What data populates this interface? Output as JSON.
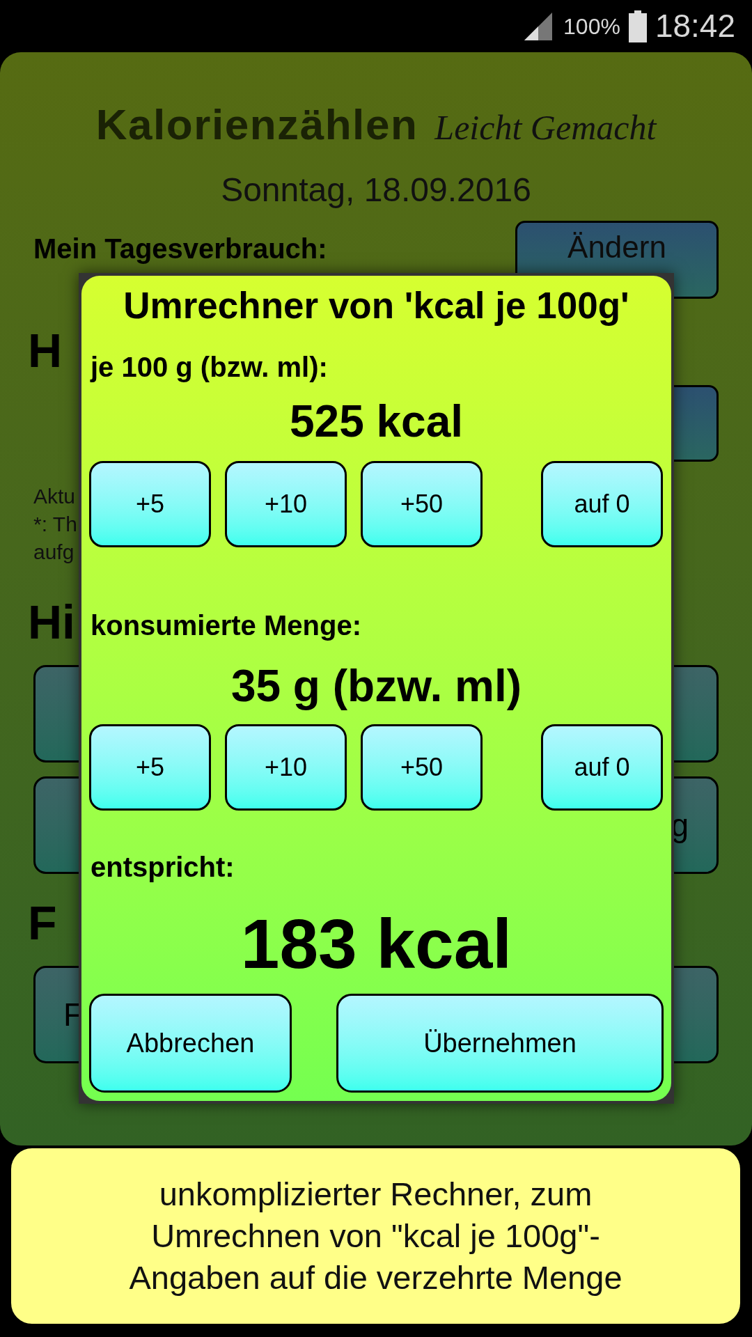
{
  "status_bar": {
    "battery": "100%",
    "time": "18:42"
  },
  "app": {
    "title": "Kalorienzählen",
    "subtitle": "Leicht Gemacht",
    "date": "Sonntag, 18.09.2016",
    "daily_label": "Mein Tagesverbrauch:",
    "change_button": "Ändern",
    "fragments": [
      {
        "kind": "heading",
        "text": "H"
      },
      {
        "kind": "small_button"
      },
      {
        "kind": "note",
        "lines": [
          "Aktu",
          "*: Th",
          "aufg"
        ]
      },
      {
        "kind": "heading",
        "text": "Hi"
      },
      {
        "kind": "button"
      },
      {
        "kind": "button_text_right",
        "text": "g"
      },
      {
        "kind": "heading",
        "text": "F"
      },
      {
        "kind": "button_text_left",
        "text": "F"
      }
    ]
  },
  "dialog": {
    "title": "Umrechner von 'kcal je 100g'",
    "sections": [
      {
        "label": "je 100 g (bzw. ml):",
        "value": "525 kcal",
        "buttons": [
          "+5",
          "+10",
          "+50",
          "auf 0"
        ]
      },
      {
        "label": "konsumierte Menge:",
        "value": "35 g (bzw. ml)",
        "buttons": [
          "+5",
          "+10",
          "+50",
          "auf 0"
        ]
      }
    ],
    "result_label": "entspricht:",
    "result": "183 kcal",
    "actions": [
      "Abbrechen",
      "Übernehmen"
    ]
  },
  "banner": {
    "lines": [
      "unkomplizierter Rechner, zum",
      "Umrechnen von \"kcal je 100g\"-",
      "Angaben auf die verzehrte Menge"
    ]
  }
}
